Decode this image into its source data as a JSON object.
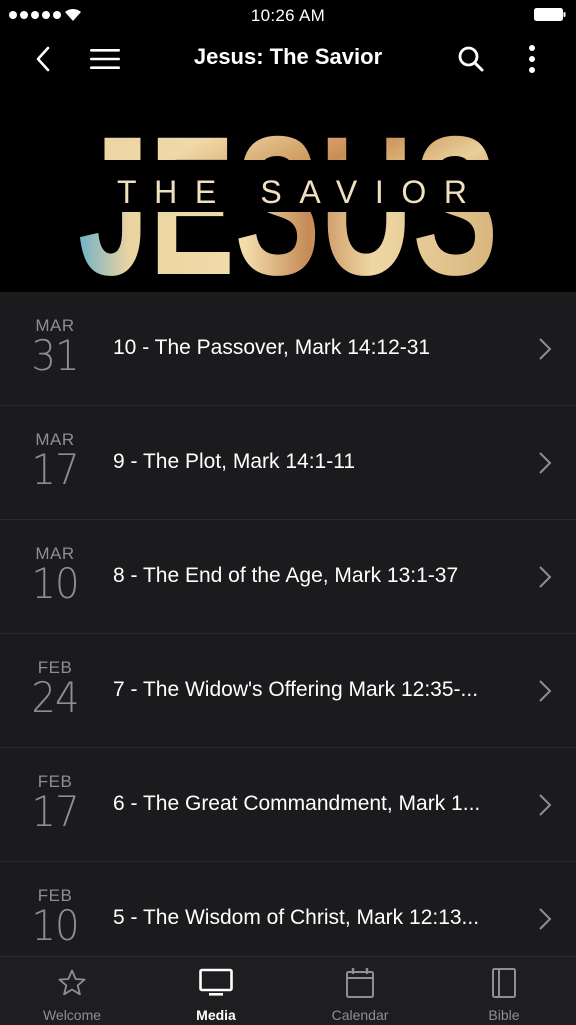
{
  "status_bar": {
    "time": "10:26 AM"
  },
  "nav": {
    "title": "Jesus: The Savior"
  },
  "banner": {
    "big_text": "JESUS",
    "subtitle": "THE SAVIOR"
  },
  "sermons": [
    {
      "month": "MAR",
      "day": "31",
      "title": "10 - The Passover, Mark 14:12-31"
    },
    {
      "month": "MAR",
      "day": "17",
      "title": "9 - The Plot, Mark 14:1-11"
    },
    {
      "month": "MAR",
      "day": "10",
      "title": "8 - The End of the Age, Mark 13:1-37"
    },
    {
      "month": "FEB",
      "day": "24",
      "title": "7 - The Widow's Offering Mark 12:35-..."
    },
    {
      "month": "FEB",
      "day": "17",
      "title": "6 - The Great Commandment, Mark 1..."
    },
    {
      "month": "FEB",
      "day": "10",
      "title": "5 - The Wisdom of Christ, Mark 12:13..."
    }
  ],
  "tabs": [
    {
      "label": "Welcome",
      "icon": "star-icon",
      "active": false
    },
    {
      "label": "Media",
      "icon": "monitor-icon",
      "active": true
    },
    {
      "label": "Calendar",
      "icon": "calendar-icon",
      "active": false
    },
    {
      "label": "Bible",
      "icon": "book-icon",
      "active": false
    }
  ],
  "colors": {
    "background": "#000000",
    "list_background": "#1b1b1d",
    "secondary_text": "#8e8e93",
    "tab_bar": "#1e1e20"
  }
}
